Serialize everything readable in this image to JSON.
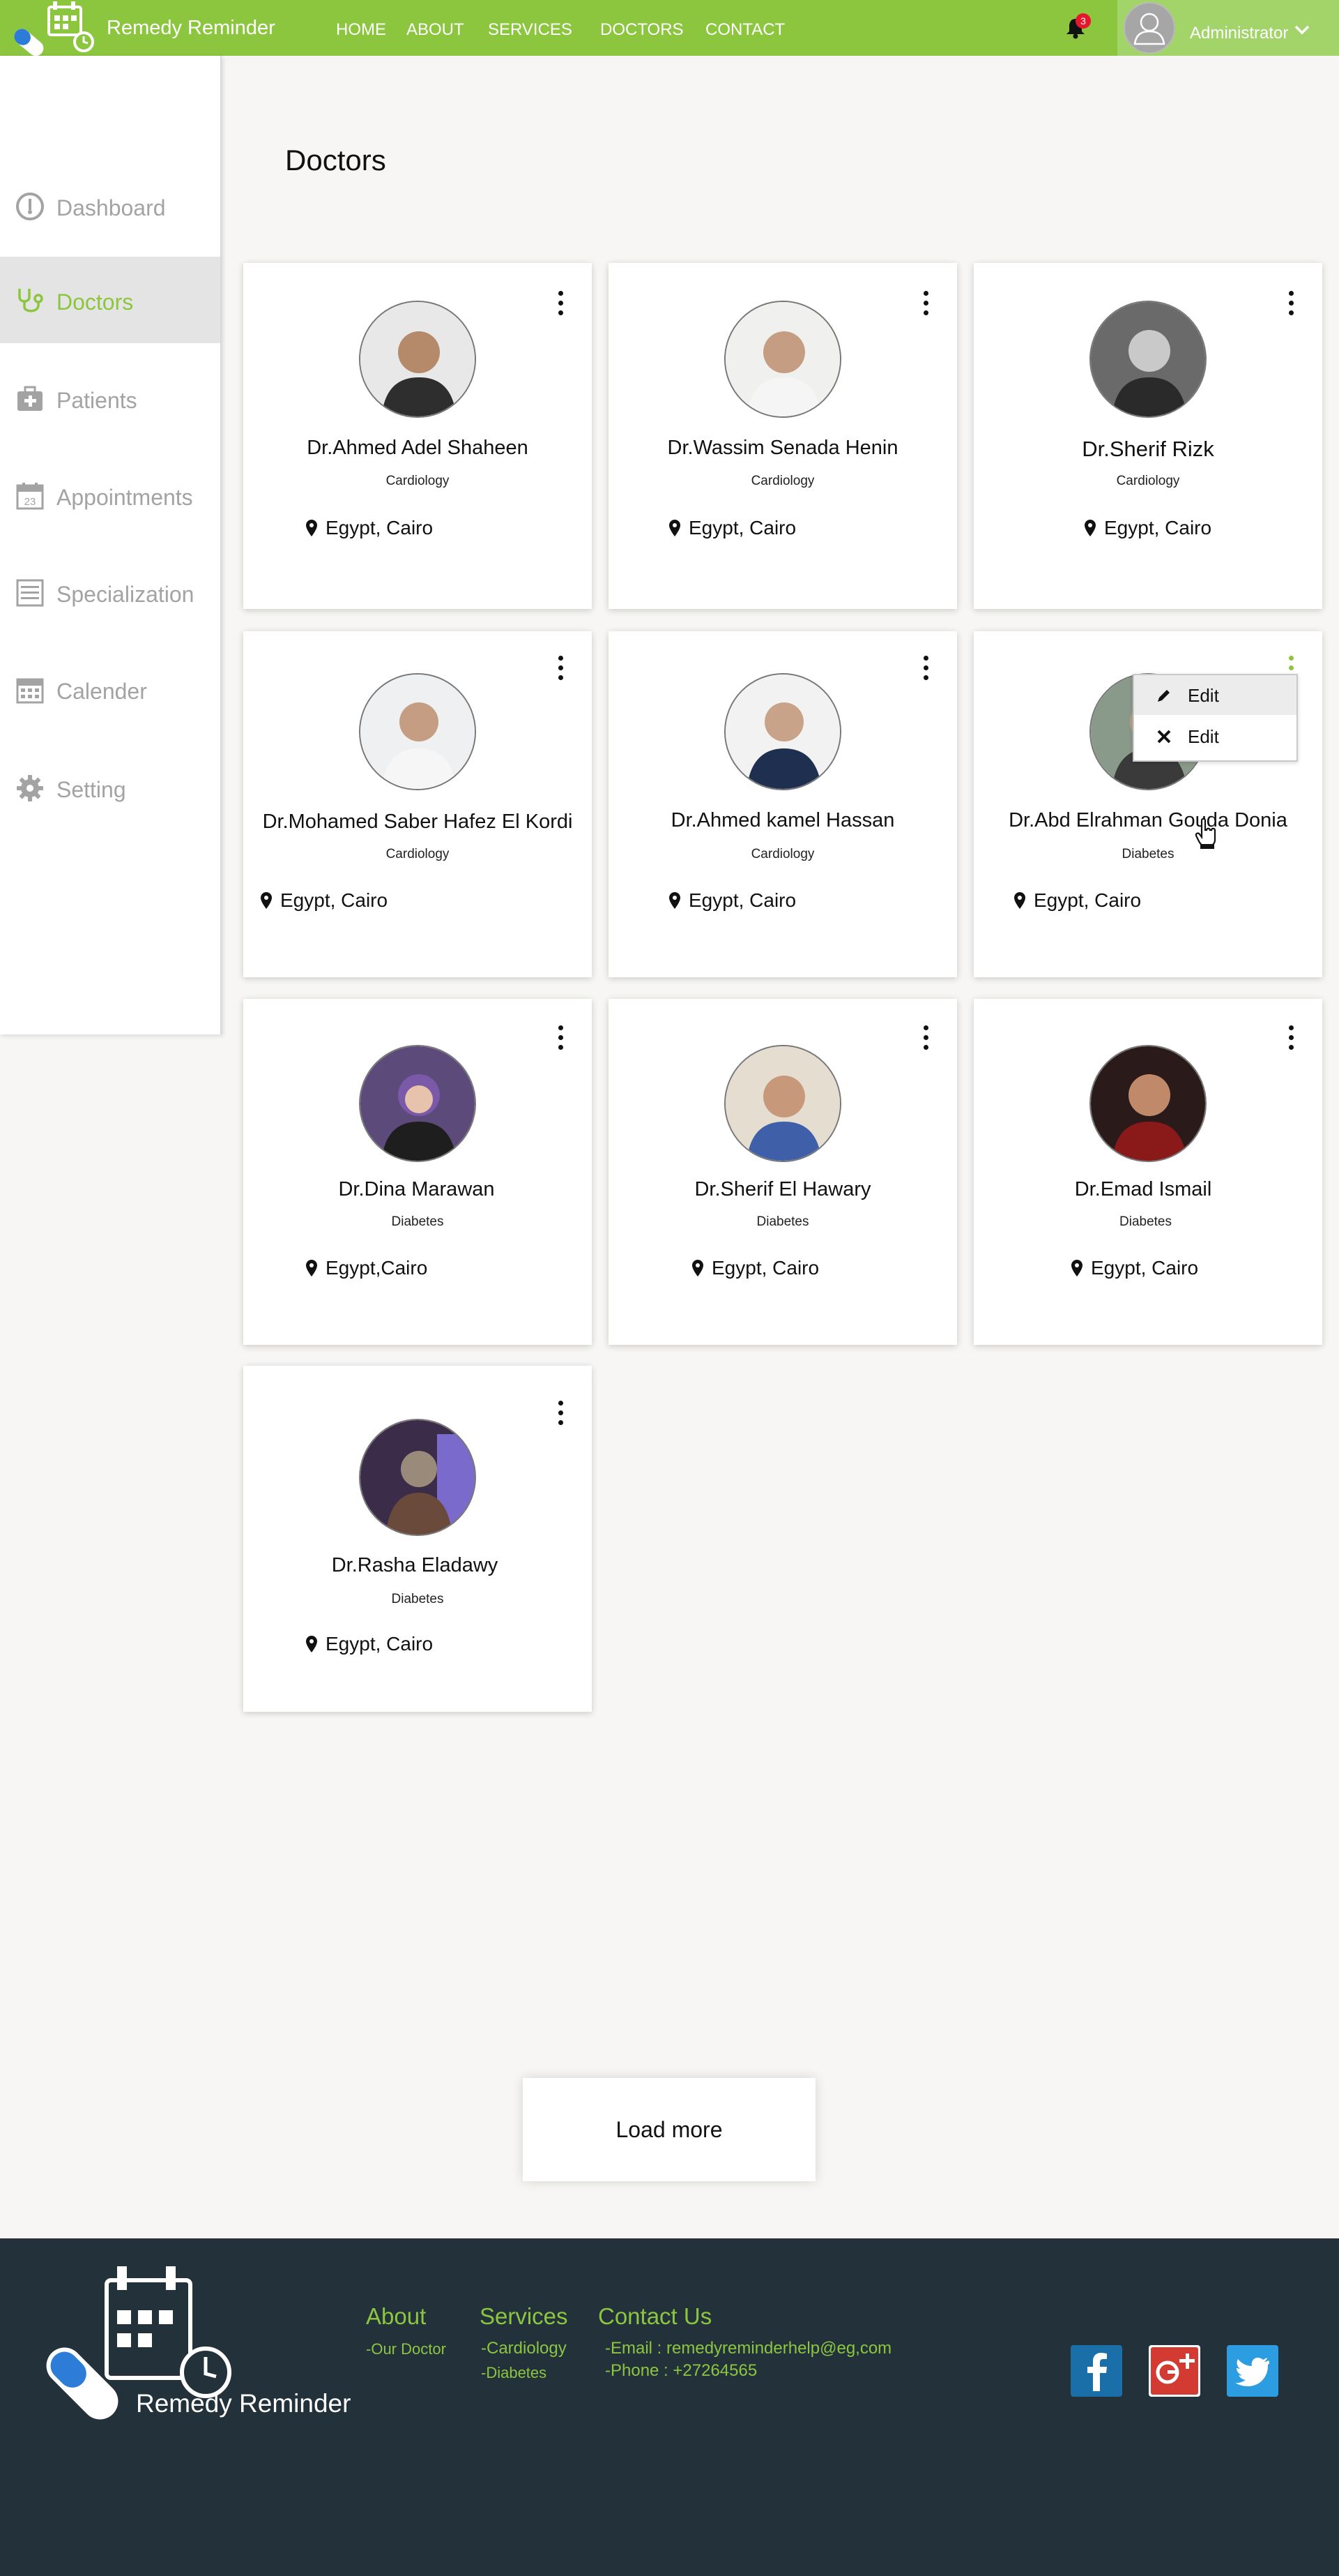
{
  "app": {
    "title": "Remedy Reminder"
  },
  "nav": {
    "home": "HOME",
    "about": "ABOUT",
    "services": "SERVICES",
    "doctors": "DOCTORS",
    "contact": "CONTACT"
  },
  "notifications": {
    "count": "3"
  },
  "user": {
    "name": "Administrator"
  },
  "sidebar": {
    "items": [
      {
        "label": "Dashboard",
        "icon": "dashboard-icon"
      },
      {
        "label": "Doctors",
        "icon": "stethoscope-icon",
        "active": true
      },
      {
        "label": "Patients",
        "icon": "medical-kit-icon"
      },
      {
        "label": "Appointments",
        "icon": "calendar-23-icon"
      },
      {
        "label": "Specialization",
        "icon": "list-icon"
      },
      {
        "label": "Calender",
        "icon": "calendar-icon"
      },
      {
        "label": "Setting",
        "icon": "gear-icon"
      }
    ]
  },
  "page": {
    "title": "Doctors"
  },
  "doctors": [
    {
      "name": "Dr.Ahmed Adel Shaheen",
      "specialty": "Cardiology",
      "location": "Egypt, Cairo"
    },
    {
      "name": "Dr.Wassim Senada Henin",
      "specialty": "Cardiology",
      "location": "Egypt, Cairo"
    },
    {
      "name": "Dr.Sherif Rizk",
      "specialty": "Cardiology",
      "location": "Egypt, Cairo"
    },
    {
      "name": "Dr.Mohamed Saber Hafez El Kordi",
      "specialty": "Cardiology",
      "location": "Egypt, Cairo"
    },
    {
      "name": "Dr.Ahmed kamel Hassan",
      "specialty": "Cardiology",
      "location": "Egypt, Cairo"
    },
    {
      "name": "Dr.Abd Elrahman Gouda Donia",
      "specialty": "Diabetes",
      "location": "Egypt, Cairo"
    },
    {
      "name": "Dr.Dina Marawan",
      "specialty": "Diabetes",
      "location": "Egypt,Cairo"
    },
    {
      "name": "Dr.Sherif El Hawary",
      "specialty": "Diabetes",
      "location": "Egypt, Cairo"
    },
    {
      "name": "Dr.Emad Ismail",
      "specialty": "Diabetes",
      "location": "Egypt, Cairo"
    },
    {
      "name": "Dr.Rasha Eladawy",
      "specialty": "Diabetes",
      "location": "Egypt, Cairo"
    }
  ],
  "card_menu": {
    "items": [
      {
        "label": "Edit",
        "icon": "pencil-icon"
      },
      {
        "label": "Edit",
        "icon": "close-icon"
      }
    ]
  },
  "load_more": "Load more",
  "footer": {
    "brand": "Remedy Reminder",
    "about": {
      "heading": "About",
      "links": [
        "-Our Doctor"
      ]
    },
    "services": {
      "heading": "Services",
      "links": [
        "-Cardiology",
        "-Diabetes"
      ]
    },
    "contact": {
      "heading": "Contact Us",
      "email": "-Email : remedyreminderhelp@eg,com",
      "phone": "-Phone : +27264565"
    },
    "social": [
      "facebook-icon",
      "google-plus-icon",
      "twitter-icon"
    ]
  },
  "colors": {
    "brand_green": "#8cc63f",
    "footer_bg": "#22313a",
    "badge_red": "#e8162c",
    "facebook_blue": "#1b6fa8",
    "google_red": "#d23a32",
    "twitter_blue": "#2b9de0"
  }
}
